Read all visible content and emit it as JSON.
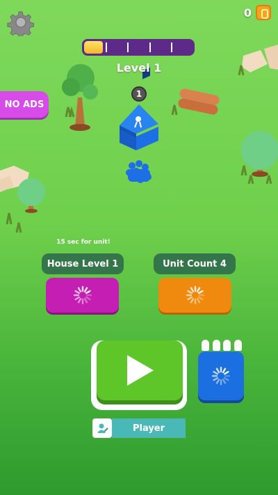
{
  "hud": {
    "coin_count": "0",
    "level_label": "Level 1",
    "level_progress": 0.17,
    "progress_segments": 5
  },
  "menu": {
    "no_ads_label": "NO ADS"
  },
  "world": {
    "house_badge": "1"
  },
  "upgrades": {
    "hint": "15 sec for unit!",
    "house_label": "House Level 1",
    "unit_label": "Unit Count 4"
  },
  "player": {
    "name": "Player"
  },
  "colors": {
    "accent_purple": "#5e2a8a",
    "house_button": "#c41eb2",
    "unit_button": "#ef8a0e",
    "play_green": "#5fc62a",
    "blue_button": "#1b6fe0"
  }
}
